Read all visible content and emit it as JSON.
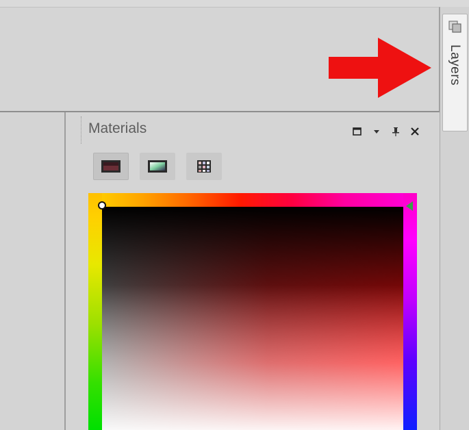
{
  "materials_panel": {
    "title": "Materials",
    "controls": {
      "restore": "restore-window-icon",
      "dropdown": "chevron-down-icon",
      "pin": "pin-icon",
      "close": "close-icon"
    },
    "modes": [
      "color-frame-icon",
      "gradient-frame-icon",
      "swatches-grid-icon"
    ]
  },
  "layers_tab": {
    "label": "Layers"
  },
  "colors": {
    "arrow": "#ee1111",
    "panel_bg": "#d5d5d5"
  }
}
